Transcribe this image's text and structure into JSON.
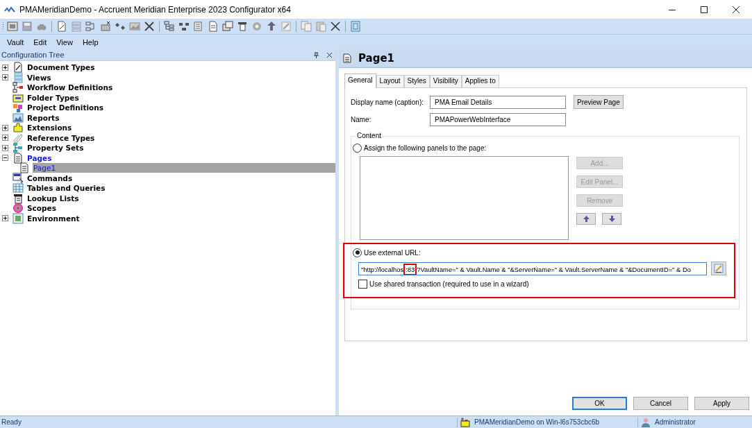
{
  "window": {
    "title": "PMAMeridianDemo - Accruent Meridian Enterprise 2023 Configurator x64"
  },
  "menu": [
    "Vault",
    "Edit",
    "View",
    "Help"
  ],
  "tree_panel": {
    "title": "Configuration Tree",
    "items": [
      {
        "label": "Document Types",
        "expanded": false,
        "selected": false
      },
      {
        "label": "Views",
        "expanded": false,
        "selected": false
      },
      {
        "label": "Workflow Definitions",
        "selected": false
      },
      {
        "label": "Folder Types",
        "selected": false
      },
      {
        "label": "Project Definitions",
        "selected": false
      },
      {
        "label": "Reports",
        "selected": false
      },
      {
        "label": "Extensions",
        "expanded": false,
        "selected": false
      },
      {
        "label": "Reference Types",
        "expanded": false,
        "selected": false
      },
      {
        "label": "Property Sets",
        "expanded": false,
        "selected": false
      },
      {
        "label": "Pages",
        "expanded": true,
        "selected": false,
        "children": [
          {
            "label": "Page1",
            "selected": true
          }
        ]
      },
      {
        "label": "Commands",
        "selected": false
      },
      {
        "label": "Tables and Queries",
        "selected": false
      },
      {
        "label": "Lookup Lists",
        "selected": false
      },
      {
        "label": "Scopes",
        "selected": false
      },
      {
        "label": "Environment",
        "expanded": false,
        "selected": false
      }
    ]
  },
  "editor": {
    "title": "Page1",
    "tabs": [
      {
        "label": "General",
        "selected": true
      },
      {
        "label": "Layout",
        "selected": false
      },
      {
        "label": "Styles",
        "selected": false
      },
      {
        "label": "Visibility",
        "selected": false
      },
      {
        "label": "Applies to",
        "selected": false
      }
    ],
    "display_name": {
      "label": "Display name (caption):",
      "value": "PMA Email Details"
    },
    "preview_button": "Preview Page",
    "name": {
      "label": "Name:",
      "value": "PMAPowerWebInterface"
    },
    "content": {
      "legend": "Content",
      "panels_option": {
        "label": "Assign the following panels to the page:",
        "selected": false
      },
      "panel_buttons": [
        {
          "label": "Add...",
          "disabled": true
        },
        {
          "label": "Edit Panel...",
          "disabled": true
        },
        {
          "label": "Remove",
          "disabled": true
        }
      ],
      "url_option": {
        "label": "Use external URL:",
        "selected": true,
        "highlighted": true
      },
      "url_field": {
        "value_segments": [
          {
            "text": "\"http://localhos",
            "highlighted": false
          },
          {
            "text": ":83",
            "highlighted": true
          },
          {
            "text": "?VaultName=\" & Vault.Name & \"&ServerName=\" & Vault.ServerName & \"&DocumentID=\" & Do",
            "highlighted": false
          }
        ]
      },
      "shared_transaction": {
        "label": "Use shared transaction (required to use in a wizard)",
        "checked": false
      }
    },
    "buttons": [
      {
        "label": "OK",
        "default": true
      },
      {
        "label": "Cancel",
        "default": false
      },
      {
        "label": "Apply",
        "default": false
      }
    ]
  },
  "status_bar": {
    "text": "Ready",
    "vault": "PMAMeridianDemo on Win-l6s753cbc6b",
    "user": "Administrator"
  }
}
